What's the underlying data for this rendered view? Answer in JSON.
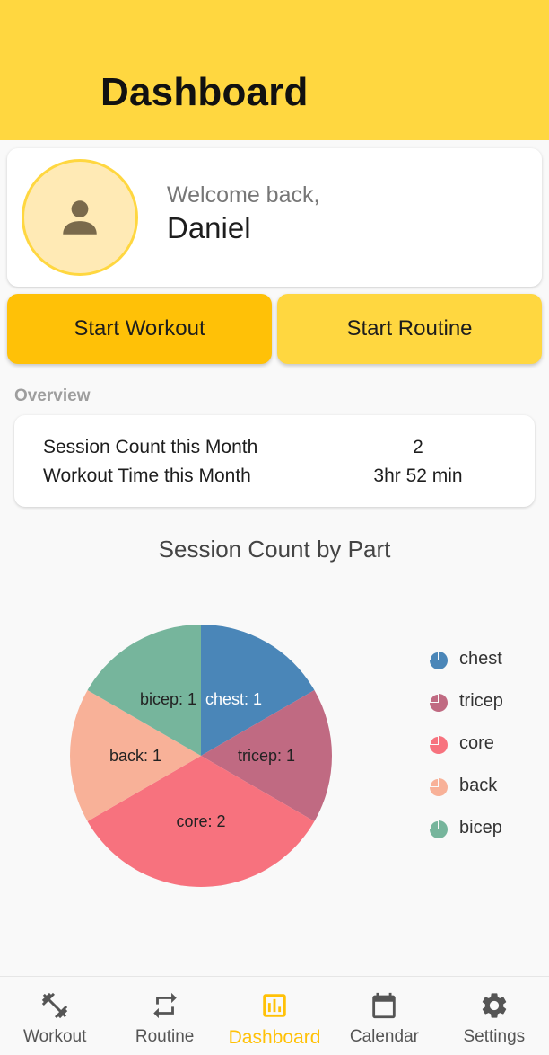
{
  "appbar": {
    "title": "Dashboard",
    "color": "#ffd740"
  },
  "profile": {
    "welcome": "Welcome back,",
    "name": "Daniel",
    "avatar_icon": "person-icon"
  },
  "actions": {
    "start_workout": "Start Workout",
    "start_routine": "Start Routine"
  },
  "overview": {
    "label": "Overview",
    "rows": [
      {
        "label": "Session Count this Month",
        "value": "2"
      },
      {
        "label": "Workout Time this Month",
        "value": "3hr 52 min"
      }
    ]
  },
  "chart_data": {
    "type": "pie",
    "title": "Session Count by Part",
    "slices": [
      {
        "label": "chest",
        "value": 1,
        "display": "chest: 1",
        "color": "#4a86b8",
        "label_color": "#ffffff"
      },
      {
        "label": "tricep",
        "value": 1,
        "display": "tricep: 1",
        "color": "#c06a82",
        "label_color": "#222222"
      },
      {
        "label": "core",
        "value": 2,
        "display": "core: 2",
        "color": "#f7727e",
        "label_color": "#222222"
      },
      {
        "label": "back",
        "value": 1,
        "display": "back: 1",
        "color": "#f8b198",
        "label_color": "#222222"
      },
      {
        "label": "bicep",
        "value": 1,
        "display": "bicep: 1",
        "color": "#76b59c",
        "label_color": "#222222"
      }
    ],
    "legend_position": "right"
  },
  "nav": {
    "items": [
      {
        "label": "Workout",
        "icon": "dumbbell-icon"
      },
      {
        "label": "Routine",
        "icon": "repeat-icon"
      },
      {
        "label": "Dashboard",
        "icon": "bar-chart-icon",
        "active": true
      },
      {
        "label": "Calendar",
        "icon": "calendar-icon"
      },
      {
        "label": "Settings",
        "icon": "gear-icon"
      }
    ],
    "active_color": "#ffc107"
  }
}
